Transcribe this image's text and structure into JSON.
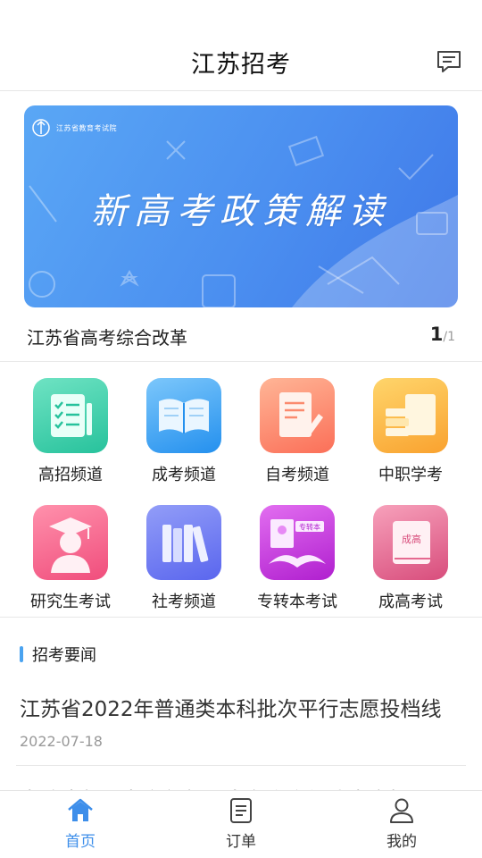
{
  "header": {
    "title": "江苏招考",
    "message_icon": "message-icon"
  },
  "banner": {
    "logo_text": "江苏省教育考试院",
    "title": "新高考政策解读",
    "caption": "江苏省高考综合改革",
    "page_current": "1",
    "page_total": "/1"
  },
  "grid": {
    "items": [
      {
        "label": "高招频道",
        "icon": "checklist-icon",
        "color": "#3ccfb0"
      },
      {
        "label": "成考频道",
        "icon": "open-book-icon",
        "color": "#3aa1f2"
      },
      {
        "label": "自考频道",
        "icon": "document-pen-icon",
        "color": "#fb8a6e"
      },
      {
        "label": "中职学考",
        "icon": "books-stack-icon",
        "color": "#f9b43f"
      },
      {
        "label": "研究生考试",
        "icon": "graduate-icon",
        "color": "#f4638b"
      },
      {
        "label": "社考频道",
        "icon": "bookshelf-icon",
        "color": "#6e7cf3"
      },
      {
        "label": "专转本考试",
        "icon": "certificate-book-icon",
        "color": "#c53ad8"
      },
      {
        "label": "成高考试",
        "icon": "closed-book-icon",
        "color": "#e56990"
      }
    ]
  },
  "news": {
    "section_title": "招考要闻",
    "items": [
      {
        "title": "江苏省2022年普通类本科批次平行志愿投档线",
        "date": "2022-07-18"
      },
      {
        "title": "省政府新闻办举行新闻发布会介绍我省高招录取工作",
        "date": ""
      }
    ]
  },
  "tabbar": {
    "items": [
      {
        "label": "首页",
        "icon": "home-icon",
        "active": true
      },
      {
        "label": "订单",
        "icon": "order-icon",
        "active": false
      },
      {
        "label": "我的",
        "icon": "user-icon",
        "active": false
      }
    ]
  },
  "colors": {
    "accent": "#3d8eea",
    "banner": "#4b8ff0"
  }
}
